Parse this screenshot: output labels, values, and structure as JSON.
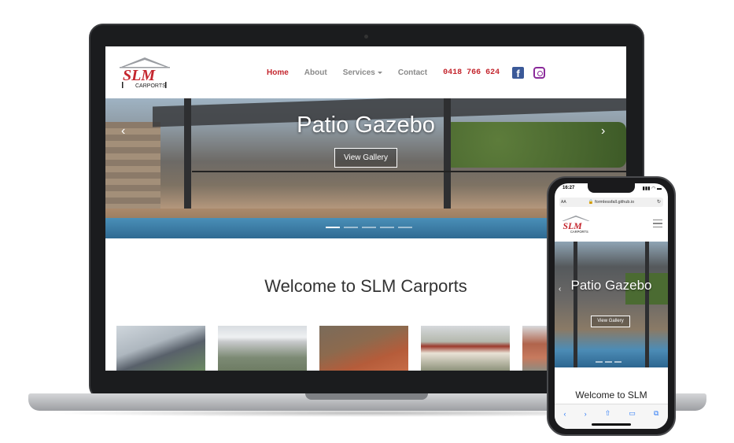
{
  "laptop": {
    "nav": {
      "logo_text": "SLM",
      "logo_sub": "CARPORTS",
      "links": [
        "Home",
        "About",
        "Services",
        "Contact"
      ],
      "phone": "0418 766 624",
      "facebook_glyph": "f"
    },
    "hero": {
      "title": "Patio Gazebo",
      "button": "View Gallery",
      "prev_arrow": "‹",
      "next_arrow": "›"
    },
    "welcome": "Welcome to SLM Carports"
  },
  "phone": {
    "time": "16:27",
    "status_icons": "▮▮▮ ◠ ▬",
    "text_size": "AA",
    "url": "🔒 formlessfall.github.io",
    "reload": "↻",
    "logo_text": "SLM",
    "logo_sub": "CARPORTS",
    "hero": {
      "title": "Patio Gazebo",
      "button": "View Gallery",
      "prev_arrow": "‹"
    },
    "welcome": "Welcome to SLM",
    "toolbar": [
      "‹",
      "›",
      "⇧",
      "▭",
      "⧉"
    ]
  }
}
